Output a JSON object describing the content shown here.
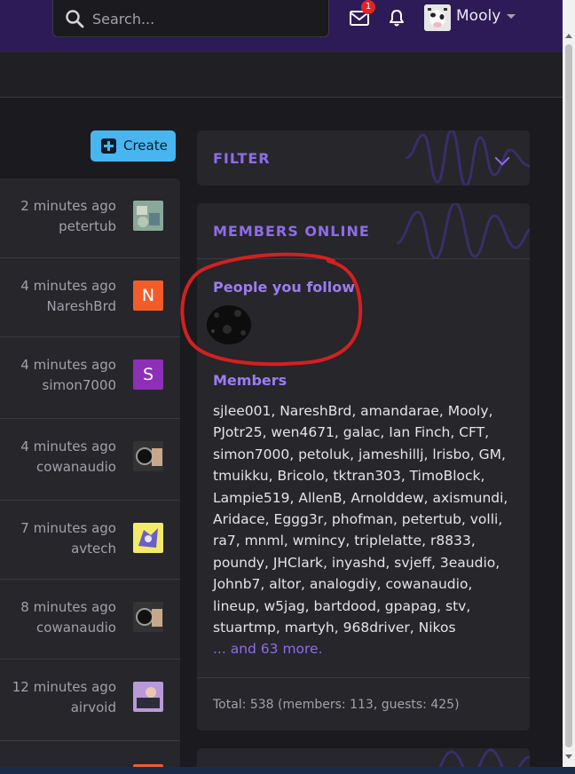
{
  "header": {
    "search_placeholder": "Search...",
    "mail_badge": "1",
    "username": "Mooly"
  },
  "toolbar": {
    "create_label": "Create"
  },
  "activity": [
    {
      "time": "2 minutes ago",
      "user": "petertub",
      "avatar": "image"
    },
    {
      "time": "4 minutes ago",
      "user": "NareshBrd",
      "avatar": "letter",
      "letter": "N",
      "color": "#f25c29"
    },
    {
      "time": "4 minutes ago",
      "user": "simon7000",
      "avatar": "letter",
      "letter": "S",
      "color": "#8e2fb8"
    },
    {
      "time": "4 minutes ago",
      "user": "cowanaudio",
      "avatar": "image"
    },
    {
      "time": "7 minutes ago",
      "user": "avtech",
      "avatar": "image"
    },
    {
      "time": "8 minutes ago",
      "user": "cowanaudio",
      "avatar": "image"
    },
    {
      "time": "12 minutes ago",
      "user": "airvoid",
      "avatar": "image"
    }
  ],
  "filter": {
    "title": "FILTER"
  },
  "members_online": {
    "title": "MEMBERS ONLINE",
    "follow_heading": "People you follow",
    "members_heading": "Members",
    "members_list": "sjlee001, NareshBrd, amandarae, Mooly, PJotr25, wen4671, galac, Ian Finch, CFT, simon7000, petoluk, jameshillj, lrisbo, GM, tmuikku, Bricolo, tktran303, TimoBlock, Lampie519, AllenB, Arnolddew, axismundi, Aridace, Eggg3r, phofman, petertub, volli, ra7, mnml, wmincy, triplelatte, r8833, poundy, JHClark, inyashd, svjeff, 3eaudio, Johnb7, altor, analogdiy, cowanaudio, lineup, w5jag, bartdood, gpapag, stv, stuartmp, martyh, 968driver, Nikos",
    "more_link": "... and 63 more.",
    "total": "Total: 538 (members: 113, guests: 425)"
  },
  "colors": {
    "accent": "#8f6ce8",
    "header_bg": "#2c1b57",
    "create_bg": "#47b6f0",
    "annotation": "#d42020"
  }
}
